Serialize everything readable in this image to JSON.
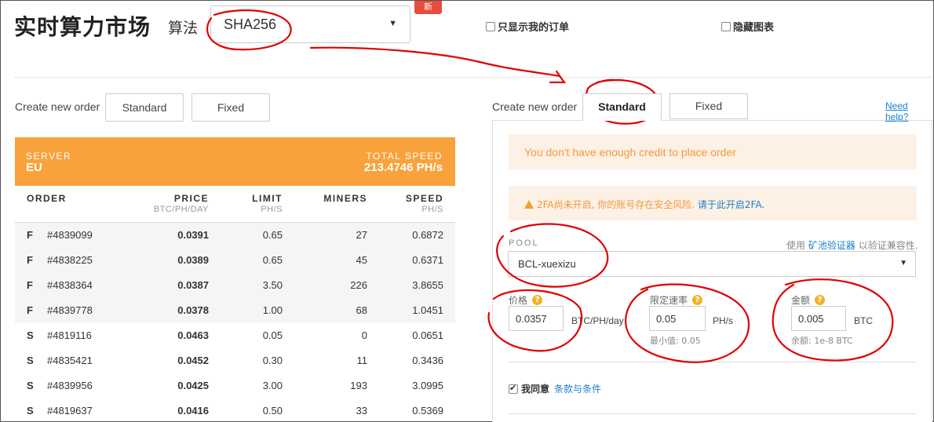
{
  "header": {
    "title": "实时算力市场",
    "algo_label": "算法",
    "algo_value": "SHA256",
    "new_badge": "新",
    "show_my_orders": "只显示我的订单",
    "hide_chart": "隐藏图表"
  },
  "left": {
    "create_label": "Create new order",
    "btn_standard": "Standard",
    "btn_fixed": "Fixed",
    "server_label": "SERVER",
    "server_value": "EU",
    "total_speed_label": "TOTAL SPEED",
    "total_speed_value": "213.4746 PH/s",
    "columns": {
      "order": "ORDER",
      "price": "PRICE",
      "price_unit": "BTC/PH/DAY",
      "limit": "LIMIT",
      "limit_unit": "PH/S",
      "miners": "MINERS",
      "speed": "SPEED",
      "speed_unit": "PH/S"
    },
    "orders": [
      {
        "type": "F",
        "id": "#4839099",
        "price": "0.0391",
        "limit": "0.65",
        "miners": "27",
        "speed": "0.6872"
      },
      {
        "type": "F",
        "id": "#4838225",
        "price": "0.0389",
        "limit": "0.65",
        "miners": "45",
        "speed": "0.6371"
      },
      {
        "type": "F",
        "id": "#4838364",
        "price": "0.0387",
        "limit": "3.50",
        "miners": "226",
        "speed": "3.8655"
      },
      {
        "type": "F",
        "id": "#4839778",
        "price": "0.0378",
        "limit": "1.00",
        "miners": "68",
        "speed": "1.0451"
      },
      {
        "type": "S",
        "id": "#4819116",
        "price": "0.0463",
        "limit": "0.05",
        "miners": "0",
        "speed": "0.0651"
      },
      {
        "type": "S",
        "id": "#4835421",
        "price": "0.0452",
        "limit": "0.30",
        "miners": "11",
        "speed": "0.3436"
      },
      {
        "type": "S",
        "id": "#4839956",
        "price": "0.0425",
        "limit": "3.00",
        "miners": "193",
        "speed": "3.0995"
      },
      {
        "type": "S",
        "id": "#4819637",
        "price": "0.0416",
        "limit": "0.50",
        "miners": "33",
        "speed": "0.5369"
      }
    ]
  },
  "right": {
    "create_label": "Create new order",
    "tab_standard": "Standard",
    "tab_fixed": "Fixed",
    "need_help": "Need help?",
    "alert_credit": "You don't have enough credit to place order",
    "alert_2fa": "2FA尚未开启, 你的账号存在安全风险.",
    "alert_2fa_link": "请于此开启2FA.",
    "pool_label": "POOL",
    "pool_hint_pre": "使用",
    "pool_hint_link": "矿池验证器",
    "pool_hint_post": "以验证兼容性.",
    "pool_value": "BCL-xuexizu",
    "price_label": "价格",
    "price_value": "0.0357",
    "price_unit": "BTC/PH/day",
    "limit_label": "限定速率",
    "limit_value": "0.05",
    "limit_unit": "PH/s",
    "limit_min": "最小值: 0.05",
    "amount_label": "金额",
    "amount_value": "0.005",
    "amount_unit": "BTC",
    "amount_balance": "余额: 1e-8 BTC",
    "agree_label": "我同意",
    "agree_link": "条款与条件"
  },
  "colors": {
    "accent_orange": "#f9a23c",
    "link_blue": "#1a7fd0",
    "badge_red": "#e74c3c",
    "annotation_red": "#e00000"
  }
}
